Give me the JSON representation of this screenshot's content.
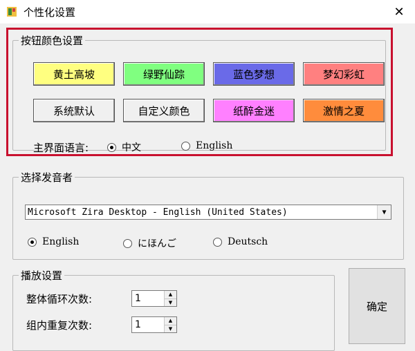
{
  "window": {
    "title": "个性化设置",
    "close_glyph": "✕"
  },
  "color_group": {
    "title": "按钮颜色设置",
    "buttons": [
      {
        "label": "黄土高坡",
        "color": "#ffff80"
      },
      {
        "label": "绿野仙踪",
        "color": "#80ff80"
      },
      {
        "label": "蓝色梦想",
        "color": "#6a6ae8"
      },
      {
        "label": "梦幻彩虹",
        "color": "#ff8080"
      },
      {
        "label": "系统默认",
        "color": "#f0f0f0"
      },
      {
        "label": "自定义颜色",
        "color": "#f0f0f0"
      },
      {
        "label": "纸醉金迷",
        "color": "#ff80ff"
      },
      {
        "label": "激情之夏",
        "color": "#ff8c3c"
      }
    ],
    "language_label": "主界面语言:",
    "language_options": [
      {
        "label": "中文",
        "selected": true
      },
      {
        "label": "English",
        "selected": false
      }
    ]
  },
  "voice_group": {
    "title": "选择发音者",
    "voice_value": "Microsoft Zira Desktop - English (United States)",
    "dropdown_arrow": "▼",
    "language_options": [
      {
        "label": "English",
        "selected": true
      },
      {
        "label": "にほんご",
        "selected": false
      },
      {
        "label": "Deutsch",
        "selected": false
      }
    ]
  },
  "play_group": {
    "title": "播放设置",
    "loop_label": "整体循环次数:",
    "loop_value": "1",
    "repeat_label": "组内重复次数:",
    "repeat_value": "1"
  },
  "ok_button": {
    "label": "确定"
  },
  "accent": {
    "highlight_border": "#c8102e"
  }
}
